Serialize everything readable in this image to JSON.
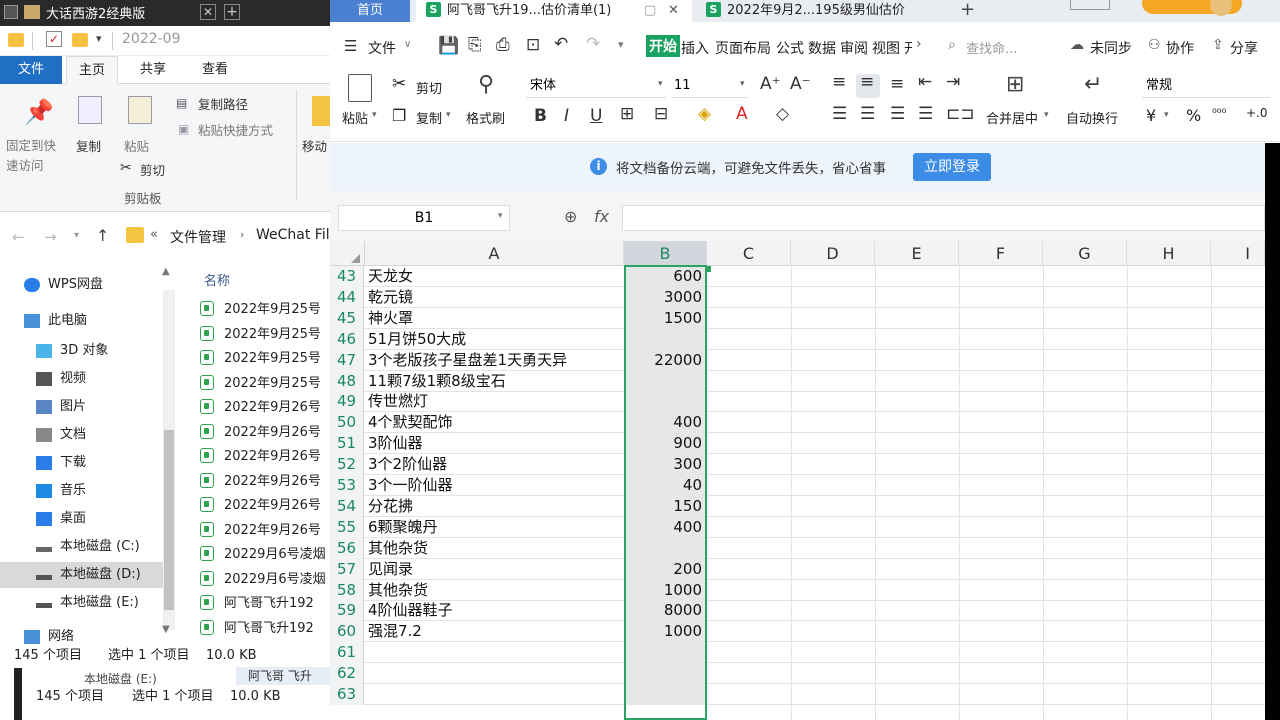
{
  "explorer": {
    "title": "大话西游2经典版",
    "path_crumb": "2022-09",
    "tabs": {
      "file": "文件",
      "home": "主页",
      "share": "共享",
      "view": "查看"
    },
    "ribbon": {
      "pin": "固定到快速访问",
      "copy": "复制",
      "paste": "粘贴",
      "copy_path": "复制路径",
      "paste_shortcut": "粘贴快捷方式",
      "cut": "剪切",
      "clipboard_group": "剪贴板",
      "move_to": "移动"
    },
    "address": {
      "sep": "«",
      "part1": "文件管理",
      "part2": "WeChat Fil"
    },
    "column_name": "名称",
    "nav": [
      {
        "label": "WPS网盘",
        "icon": "cloud-icon"
      },
      {
        "label": "此电脑",
        "icon": "computer-icon"
      },
      {
        "label": "3D 对象",
        "icon": "cube-icon"
      },
      {
        "label": "视频",
        "icon": "video-icon"
      },
      {
        "label": "图片",
        "icon": "picture-icon"
      },
      {
        "label": "文档",
        "icon": "document-icon"
      },
      {
        "label": "下载",
        "icon": "download-icon"
      },
      {
        "label": "音乐",
        "icon": "music-icon"
      },
      {
        "label": "桌面",
        "icon": "desktop-icon"
      },
      {
        "label": "本地磁盘 (C:)",
        "icon": "drive-icon"
      },
      {
        "label": "本地磁盘 (D:)",
        "icon": "drive-icon"
      },
      {
        "label": "本地磁盘 (E:)",
        "icon": "drive-icon"
      },
      {
        "label": "网络",
        "icon": "network-icon"
      }
    ],
    "files": [
      "2022年9月25号",
      "2022年9月25号",
      "2022年9月25号",
      "2022年9月25号",
      "2022年9月26号",
      "2022年9月26号",
      "2022年9月26号",
      "2022年9月26号",
      "2022年9月26号",
      "2022年9月26号",
      "20229月6号凌烟",
      "20229月6号凌烟",
      "阿飞哥飞升192",
      "阿飞哥飞升192"
    ],
    "status": {
      "count": "145 个项目",
      "selected": "选中 1 个项目",
      "size": "10.0 KB"
    },
    "bg_window": {
      "drive": "本地磁盘 (E:)",
      "file": "阿飞哥 飞升",
      "count": "145 个项目",
      "selected": "选中 1 个项目",
      "size": "10.0 KB"
    }
  },
  "wps": {
    "tabs": [
      {
        "label": "首页"
      },
      {
        "label": "阿飞哥飞升19...估价清单(1)"
      },
      {
        "label": "2022年9月2...195级男仙估价"
      }
    ],
    "menu": {
      "file": "文件",
      "start": "开始",
      "items": [
        "插入",
        "页面布局",
        "公式",
        "数据",
        "审阅",
        "视图",
        "开"
      ],
      "search": "查找命...",
      "sync": "未同步",
      "collab": "协作",
      "share": "分享"
    },
    "toolbar": {
      "paste": "粘贴",
      "cut": "剪切",
      "copy": "复制",
      "format_painter": "格式刷",
      "font": "宋体",
      "size": "11",
      "merge": "合并居中",
      "wrap": "自动换行",
      "number_format": "常规"
    },
    "notice": {
      "text": "将文档备份云端，可避免文件丢失，省心省事",
      "button": "立即登录"
    },
    "formula": {
      "cell_ref": "B1",
      "fx": "fx",
      "value": ""
    },
    "columns": [
      "A",
      "B",
      "C",
      "D",
      "E",
      "F",
      "G",
      "H",
      "I"
    ],
    "rows": [
      {
        "n": "43",
        "a": "天龙女",
        "b": "600"
      },
      {
        "n": "44",
        "a": "乾元镜",
        "b": "3000"
      },
      {
        "n": "45",
        "a": "神火罩",
        "b": "1500"
      },
      {
        "n": "46",
        "a": "51月饼50大成",
        "b": ""
      },
      {
        "n": "47",
        "a": "3个老版孩子星盘差1天勇天异",
        "b": "22000"
      },
      {
        "n": "48",
        "a": "11颗7级1颗8级宝石",
        "b": ""
      },
      {
        "n": "49",
        "a": "传世燃灯",
        "b": ""
      },
      {
        "n": "50",
        "a": "4个默契配饰",
        "b": "400"
      },
      {
        "n": "51",
        "a": "3阶仙器",
        "b": "900"
      },
      {
        "n": "52",
        "a": "3个2阶仙器",
        "b": "300"
      },
      {
        "n": "53",
        "a": "3个一阶仙器",
        "b": "40"
      },
      {
        "n": "54",
        "a": "分花拂",
        "b": "150"
      },
      {
        "n": "55",
        "a": "6颗聚魄丹",
        "b": "400"
      },
      {
        "n": "56",
        "a": "其他杂货",
        "b": ""
      },
      {
        "n": "57",
        "a": "见闻录",
        "b": "200"
      },
      {
        "n": "58",
        "a": "其他杂货",
        "b": "1000"
      },
      {
        "n": "59",
        "a": "4阶仙器鞋子",
        "b": "8000"
      },
      {
        "n": "60",
        "a": "强混7.2",
        "b": "1000"
      },
      {
        "n": "61",
        "a": "",
        "b": ""
      },
      {
        "n": "62",
        "a": "",
        "b": ""
      },
      {
        "n": "63",
        "a": "",
        "b": ""
      }
    ]
  },
  "colors": {
    "accent": "#1f6fc5",
    "wps_green": "#2aa365",
    "login_blue": "#3d8ce6"
  }
}
